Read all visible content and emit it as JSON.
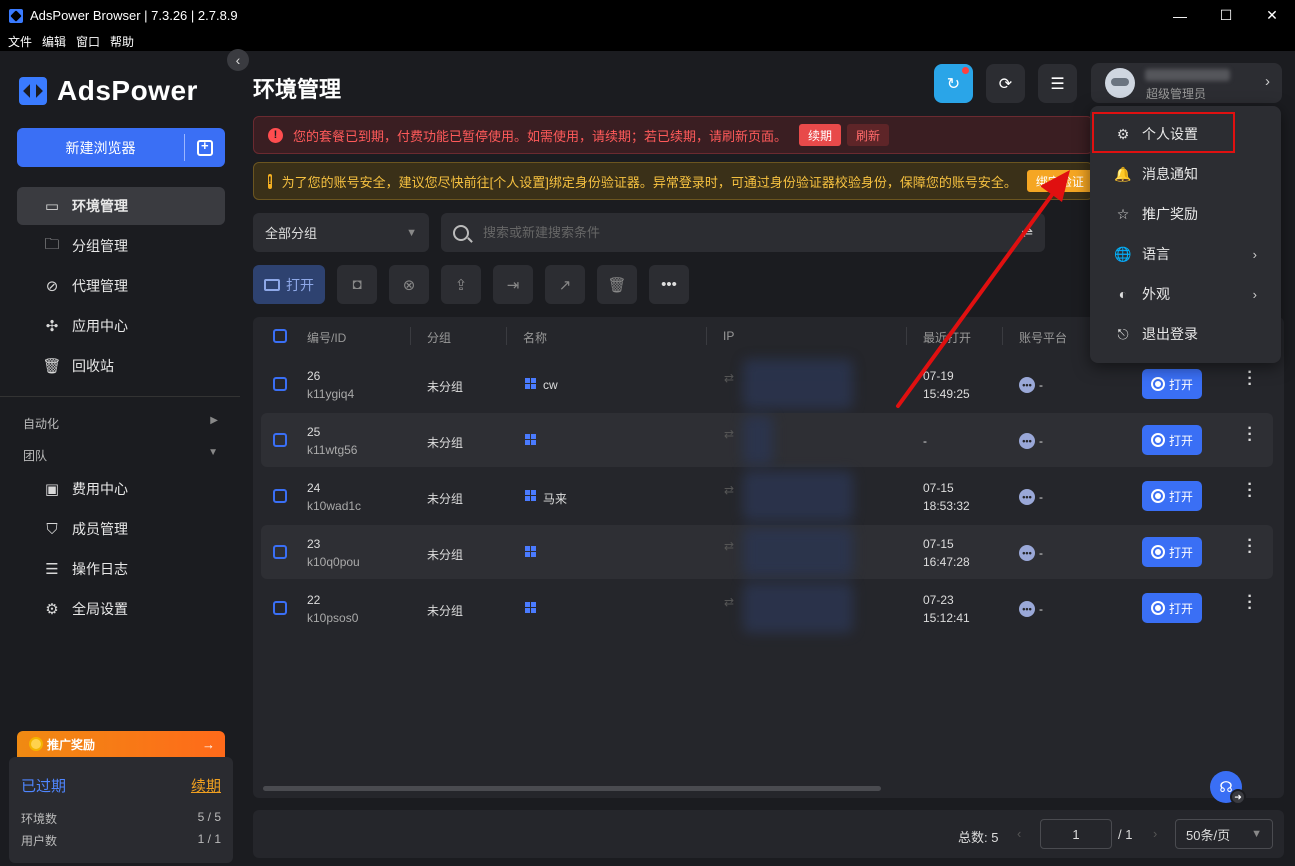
{
  "window": {
    "title": "AdsPower Browser | 7.3.26 | 2.7.8.9",
    "controls": [
      "—",
      "☐",
      "✕"
    ]
  },
  "menubar": [
    "文件",
    "编辑",
    "窗口",
    "帮助"
  ],
  "brand": {
    "name": "AdsPower"
  },
  "sidebar": {
    "new_browser": "新建浏览器",
    "items": [
      {
        "label": "环境管理",
        "icon": "window-icon",
        "glyph": "▭",
        "active": true
      },
      {
        "label": "分组管理",
        "icon": "folder-icon",
        "glyph": "🗀"
      },
      {
        "label": "代理管理",
        "icon": "proxy-icon",
        "glyph": "⊘"
      },
      {
        "label": "应用中心",
        "icon": "puzzle-icon",
        "glyph": "✣"
      },
      {
        "label": "回收站",
        "icon": "trash-icon",
        "glyph": "🗑"
      }
    ],
    "automation_label": "自动化",
    "team_label": "团队",
    "team_items": [
      {
        "label": "费用中心",
        "icon": "billing-icon",
        "glyph": "▣"
      },
      {
        "label": "成员管理",
        "icon": "shield-member-icon",
        "glyph": "⛉"
      },
      {
        "label": "操作日志",
        "icon": "log-icon",
        "glyph": "☰"
      },
      {
        "label": "全局设置",
        "icon": "settings-icon",
        "glyph": "⚙"
      }
    ],
    "promo_label": "推广奖励",
    "promo_arrow": "→",
    "plan": {
      "status": "已过期",
      "renew": "续期",
      "env_label": "环境数",
      "env_value": "5 / 5",
      "user_label": "用户数",
      "user_value": "1 / 1"
    }
  },
  "header": {
    "title": "环境管理",
    "user_role": "超级管理员"
  },
  "alerts": {
    "error_text": "您的套餐已到期，付费功能已暂停使用。如需使用，请续期；若已续期，请刷新页面。",
    "error_renew": "续期",
    "error_refresh": "刷新",
    "warn_text": "为了您的账号安全，建议您尽快前往[个人设置]绑定身份验证器。异常登录时，可通过身份验证器校验身份，保障您的账号安全。",
    "warn_button": "绑定验证"
  },
  "filters": {
    "group_select": "全部分组",
    "search_placeholder": "搜索或新建搜索条件"
  },
  "toolbar": {
    "open_label": "打开"
  },
  "table": {
    "columns": [
      "编号/ID",
      "分组",
      "名称",
      "IP",
      "最近打开",
      "账号平台"
    ],
    "rows": [
      {
        "no": "26",
        "id": "k11ygiq4",
        "group": "未分组",
        "name": "cw",
        "last_date": "07-19",
        "last_time": "15:49:25",
        "platform": "-",
        "action": "打开"
      },
      {
        "no": "25",
        "id": "k11wtg56",
        "group": "未分组",
        "name": "",
        "last_date": "-",
        "last_time": "",
        "platform": "-",
        "action": "打开"
      },
      {
        "no": "24",
        "id": "k10wad1c",
        "group": "未分组",
        "name": "马来",
        "last_date": "07-15",
        "last_time": "18:53:32",
        "platform": "-",
        "action": "打开"
      },
      {
        "no": "23",
        "id": "k10q0pou",
        "group": "未分组",
        "name": "",
        "last_date": "07-15",
        "last_time": "16:47:28",
        "platform": "-",
        "action": "打开"
      },
      {
        "no": "22",
        "id": "k10psos0",
        "group": "未分组",
        "name": "",
        "last_date": "07-23",
        "last_time": "15:12:41",
        "platform": "-",
        "action": "打开"
      }
    ]
  },
  "pager": {
    "total": "总数: 5",
    "page": "1",
    "of": "/ 1",
    "size": "50条/页"
  },
  "user_menu": {
    "items": [
      {
        "label": "个人设置",
        "icon": "gear-icon",
        "glyph": "⚙",
        "has_sub": false
      },
      {
        "label": "消息通知",
        "icon": "bell-icon",
        "glyph": "🔔",
        "has_sub": false
      },
      {
        "label": "推广奖励",
        "icon": "star-icon",
        "glyph": "☆",
        "has_sub": false
      },
      {
        "label": "语言",
        "icon": "globe-icon",
        "glyph": "🌐",
        "has_sub": true
      },
      {
        "label": "外观",
        "icon": "theme-icon",
        "glyph": "◐",
        "has_sub": true
      },
      {
        "label": "退出登录",
        "icon": "logout-icon",
        "glyph": "⎋",
        "has_sub": false
      }
    ]
  },
  "colors": {
    "accent": "#3a6ff5",
    "annotation_red": "#e01010"
  }
}
